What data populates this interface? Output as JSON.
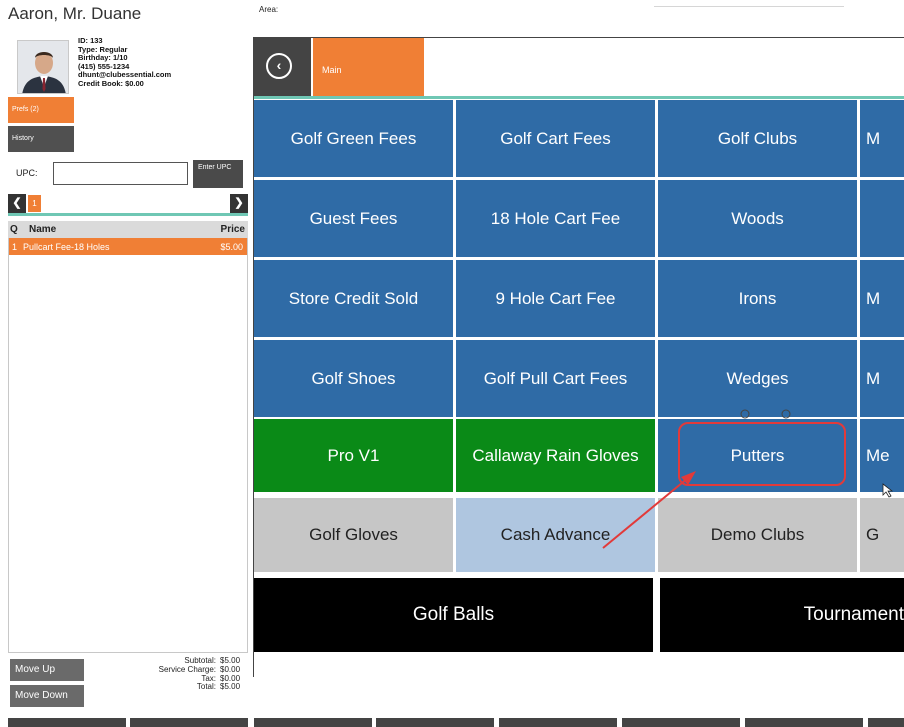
{
  "customer": {
    "name": "Aaron, Mr. Duane",
    "info": [
      "ID: 133",
      "Type: Regular",
      "Birthday: 1/10",
      "(415) 555-1234",
      "dhunt@clubessential.com",
      "Credit Book: $0.00"
    ]
  },
  "sidebar": {
    "prefs_label": "Prefs (2)",
    "history_label": "History"
  },
  "upc": {
    "label": "UPC:",
    "value": "",
    "enter_label": "Enter UPC"
  },
  "tabs": {
    "prev_icon": "chevron-left-icon",
    "next_icon": "chevron-right-icon",
    "active": "1"
  },
  "items_table": {
    "headers": {
      "q": "Q",
      "name": "Name",
      "price": "Price"
    },
    "rows": [
      {
        "q": "1",
        "name": "Pullcart Fee-18 Holes",
        "price": "$5.00"
      }
    ]
  },
  "actions": {
    "move_up": "Move Up",
    "move_down": "Move Down"
  },
  "totals": {
    "subtotal_label": "Subtotal:",
    "subtotal": "$5.00",
    "service_label": "Service Charge:",
    "service": "$0.00",
    "tax_label": "Tax:",
    "tax": "$0.00",
    "total_label": "Total:",
    "total": "$5.00"
  },
  "area": {
    "label": "Area:"
  },
  "nav": {
    "back_icon": "back-arrow-icon",
    "current_tab": "Main"
  },
  "tiles": {
    "golf_green_fees": "Golf Green Fees",
    "golf_cart_fees": "Golf Cart  Fees",
    "golf_clubs": "Golf Clubs",
    "col4_row1": "M",
    "guest_fees": "Guest Fees",
    "hole18_cart_fee": "18 Hole Cart Fee",
    "woods": "Woods",
    "store_credit_sold": "Store Credit Sold",
    "hole9_cart_fee": "9 Hole Cart Fee",
    "irons": "Irons",
    "col4_row3": "M",
    "golf_shoes": "Golf Shoes",
    "golf_pull_cart_fees": "Golf Pull Cart Fees",
    "wedges": "Wedges",
    "col4_row4": "M",
    "pro_v1": "Pro V1",
    "callaway_rain_gloves": "Callaway Rain Gloves",
    "putters": "Putters",
    "col4_row5": "Me",
    "golf_gloves": "Golf Gloves",
    "cash_advance": "Cash Advance",
    "demo_clubs": "Demo  Clubs",
    "col4_row6": "G",
    "golf_balls": "Golf Balls",
    "tournament": "Tournament"
  },
  "colors": {
    "accent_orange": "#f07f35",
    "tile_blue": "#2f6ba6",
    "tile_green": "#0a8a17",
    "tile_gray": "#c6c6c6",
    "tile_lightblue": "#afc6e0",
    "teal": "#6fc7b4",
    "annotation_red": "#e23a3a"
  }
}
